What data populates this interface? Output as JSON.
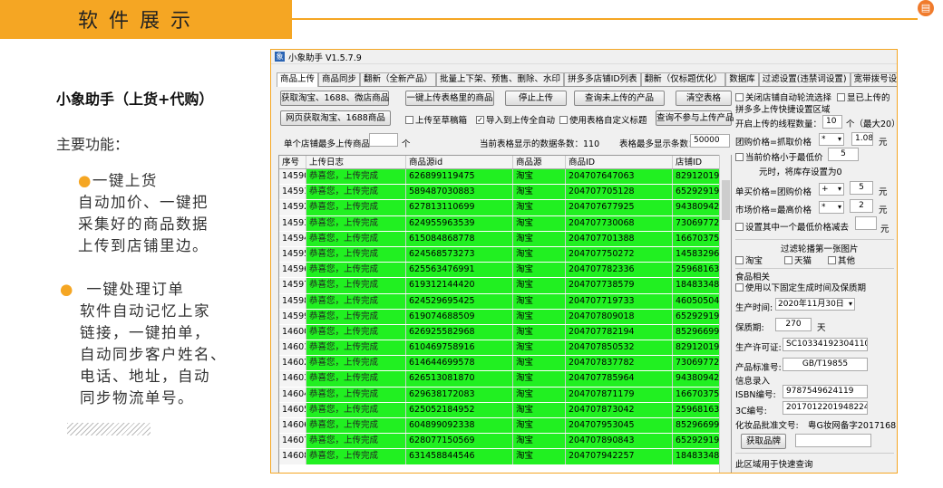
{
  "header": {
    "title": "软件展示"
  },
  "left": {
    "title": "小象助手（上货+代购）",
    "subtitle": "主要功能：",
    "features": [
      {
        "title": "一键上货",
        "body": [
          "自动加价、一键把",
          "采集好的商品数据",
          "上传到店铺里边。"
        ]
      },
      {
        "title": "一键处理订单",
        "body": [
          "软件自动记忆上家",
          "链接，一键拍单，",
          "自动同步客户姓名、",
          "电话、地址，自动",
          "同步物流单号。"
        ]
      }
    ]
  },
  "app": {
    "title": "小象助手 V1.5.7.9",
    "tabs": [
      "商品上传",
      "商品同步",
      "翻新（全新产品）",
      "批量上下架、预售、删除、水印",
      "拼多多店铺ID列表",
      "翻新（仅标题优化）",
      "数据库",
      "过滤设置(违禁词设置)",
      "宽带拨号设置及代理设"
    ],
    "buttons": {
      "fetch": "获取淘宝、1688、微店商品",
      "upload_all": "一键上传表格里的商品",
      "stop": "停止上传",
      "query_not_uploaded": "查询未上传的产品",
      "clear": "清空表格",
      "web_fetch": "网页获取淘宝、1688商品",
      "query_excluded": "查询不参与上传产品",
      "get_brand": "获取品牌"
    },
    "checks": {
      "draft": "上传至草稿箱",
      "auto_import": "导入到上传全自动",
      "custom_title": "使用表格自定义标题",
      "close_shop_poll": "关闭店铺自动轮流选择",
      "show_uploaded": "显已上传的",
      "below_min": "当前价格小于最低价",
      "set_min_price": "设置其中一个最低价格减去",
      "taobao": "淘宝",
      "tmall": "天猫",
      "other": "其他",
      "use_fixed_date": "使用以下固定生成时间及保质期"
    },
    "labels": {
      "max_upload": "单个店铺最多上传商品：",
      "max_upload_unit": "个",
      "table_count_label": "当前表格显示的数据条数：",
      "table_count": "110",
      "table_max_label": "表格最多显示条数：",
      "table_max": "50000",
      "quick_area": "拼多多上传快捷设置区域",
      "threads_label": "开启上传的线程数量：",
      "threads": "10",
      "threads_unit": "个（最大20）",
      "group_price": "团购价格=抓取价格",
      "group_mult": "1.08",
      "yuan": "元",
      "min_price": "5",
      "min_note": "元时，将库存设置为0",
      "single_price": "单买价格=团购价格",
      "single_add": "5",
      "market_price": "市场价格=最高价格",
      "market_mult": "2",
      "filter_title": "过滤轮播第一张图片",
      "food": "食品相关",
      "prod_time_label": "生产时间:",
      "prod_time": "2020年11月30日",
      "shelf_life_label": "保质期:",
      "shelf_life": "270",
      "shelf_unit": "天",
      "license_label": "生产许可证:",
      "license": "SC10334192304110",
      "standard_label": "产品标准号:",
      "standard": "GB/T19855",
      "info": "信息录入",
      "isbn_label": "ISBN编号:",
      "isbn": "9787549624119",
      "ccc_label": "3C编号:",
      "ccc": "2017012201948224",
      "cosmetic_label": "化妆品批准文号:",
      "cosmetic": "粤G妆网备字2017168",
      "quick_query": "此区域用于快速查询"
    },
    "columns": [
      "序号",
      "上传日志",
      "商品源id",
      "商品源",
      "商品ID",
      "店铺ID"
    ],
    "rows": [
      [
        "14590",
        "恭喜您，上传完成",
        "626899119475",
        "淘宝",
        "204707647063",
        "829120190"
      ],
      [
        "14591",
        "恭喜您，上传完成",
        "589487030883",
        "淘宝",
        "204707705128",
        "652929194"
      ],
      [
        "14592",
        "恭喜您，上传完成",
        "627813110699",
        "淘宝",
        "204707677925",
        "943809421"
      ],
      [
        "14593",
        "恭喜您，上传完成",
        "624955963539",
        "淘宝",
        "204707730068",
        "730697724"
      ],
      [
        "14594",
        "恭喜您，上传完成",
        "615084868778",
        "淘宝",
        "204707701388",
        "166703754"
      ],
      [
        "14595",
        "恭喜您，上传完成",
        "624568573273",
        "淘宝",
        "204707750272",
        "145832969"
      ],
      [
        "14596",
        "恭喜您，上传完成",
        "625563476991",
        "淘宝",
        "204707782336",
        "259681635"
      ],
      [
        "14597",
        "恭喜您，上传完成",
        "619312144420",
        "淘宝",
        "204707738579",
        "184833480"
      ],
      [
        "14598",
        "恭喜您，上传完成",
        "624529695425",
        "淘宝",
        "204707719733",
        "460505044"
      ],
      [
        "14599",
        "恭喜您，上传完成",
        "619074688509",
        "淘宝",
        "204707809018",
        "652929194"
      ],
      [
        "14600",
        "恭喜您，上传完成",
        "626925582968",
        "淘宝",
        "204707782194",
        "852966994"
      ],
      [
        "14601",
        "恭喜您，上传完成",
        "610469758916",
        "淘宝",
        "204707850532",
        "829120190"
      ],
      [
        "14602",
        "恭喜您，上传完成",
        "614644699578",
        "淘宝",
        "204707837782",
        "730697724"
      ],
      [
        "14603",
        "恭喜您，上传完成",
        "626513081870",
        "淘宝",
        "204707785964",
        "943809421"
      ],
      [
        "14604",
        "恭喜您，上传完成",
        "629638172083",
        "淘宝",
        "204707871179",
        "166703754"
      ],
      [
        "14605",
        "恭喜您，上传完成",
        "625052184952",
        "淘宝",
        "204707873042",
        "259681635"
      ],
      [
        "14606",
        "恭喜您，上传完成",
        "604899092338",
        "淘宝",
        "204707953045",
        "852966994"
      ],
      [
        "14607",
        "恭喜您，上传完成",
        "628077150569",
        "淘宝",
        "204707890843",
        "652929194"
      ],
      [
        "14608",
        "恭喜您，上传完成",
        "631458844546",
        "淘宝",
        "204707942257",
        "184833480"
      ]
    ]
  }
}
